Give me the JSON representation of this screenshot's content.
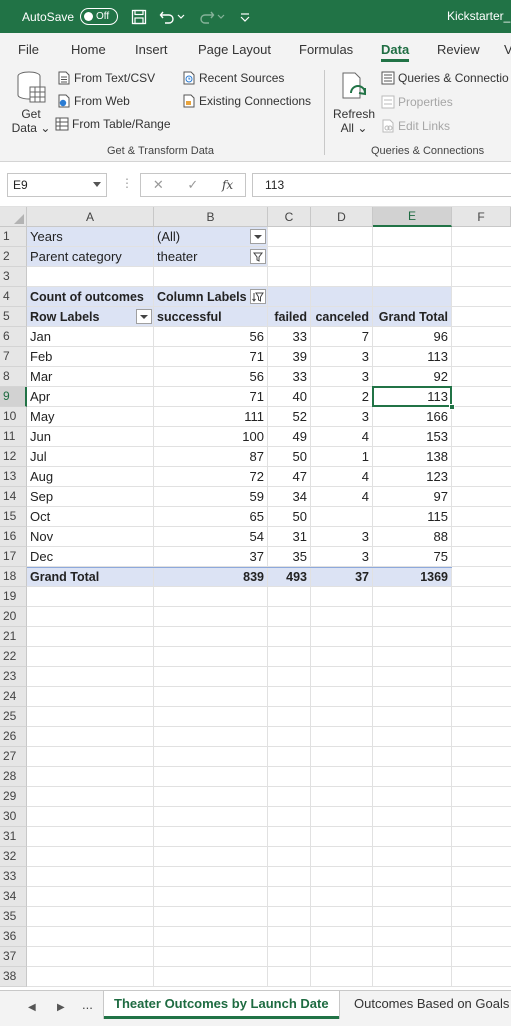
{
  "titlebar": {
    "autosave_label": "AutoSave",
    "autosave_state": "Off",
    "file_title": "Kickstarter_C"
  },
  "ribbon_tabs": [
    {
      "label": "File"
    },
    {
      "label": "Home"
    },
    {
      "label": "Insert"
    },
    {
      "label": "Page Layout"
    },
    {
      "label": "Formulas"
    },
    {
      "label": "Data",
      "active": true
    },
    {
      "label": "Review"
    },
    {
      "label": "V"
    }
  ],
  "ribbon": {
    "get_data": {
      "line1": "Get",
      "line2": "Data"
    },
    "from_text_csv": "From Text/CSV",
    "from_web": "From Web",
    "from_table_range": "From Table/Range",
    "recent_sources": "Recent Sources",
    "existing_connections": "Existing Connections",
    "group_get_transform": "Get & Transform Data",
    "refresh_all": {
      "line1": "Refresh",
      "line2": "All"
    },
    "queries_connections": "Queries & Connectio",
    "properties": "Properties",
    "edit_links": "Edit Links",
    "group_queries": "Queries & Connections",
    "accent": "#217346"
  },
  "formula_bar": {
    "name_box": "E9",
    "fx_label": "fx",
    "value": "113"
  },
  "columns": [
    "A",
    "B",
    "C",
    "D",
    "E",
    "F"
  ],
  "selected_column": "E",
  "selected_row": 9,
  "filters": {
    "years_label": "Years",
    "years_value": "(All)",
    "parent_label": "Parent category",
    "parent_value": "theater"
  },
  "pivot": {
    "count_label": "Count of outcomes",
    "column_labels": "Column Labels",
    "row_labels": "Row Labels",
    "headers": [
      "successful",
      "failed",
      "canceled",
      "Grand Total"
    ],
    "rows": [
      {
        "label": "Jan",
        "successful": "56",
        "failed": "33",
        "canceled": "7",
        "total": "96"
      },
      {
        "label": "Feb",
        "successful": "71",
        "failed": "39",
        "canceled": "3",
        "total": "113"
      },
      {
        "label": "Mar",
        "successful": "56",
        "failed": "33",
        "canceled": "3",
        "total": "92"
      },
      {
        "label": "Apr",
        "successful": "71",
        "failed": "40",
        "canceled": "2",
        "total": "113"
      },
      {
        "label": "May",
        "successful": "111",
        "failed": "52",
        "canceled": "3",
        "total": "166"
      },
      {
        "label": "Jun",
        "successful": "100",
        "failed": "49",
        "canceled": "4",
        "total": "153"
      },
      {
        "label": "Jul",
        "successful": "87",
        "failed": "50",
        "canceled": "1",
        "total": "138"
      },
      {
        "label": "Aug",
        "successful": "72",
        "failed": "47",
        "canceled": "4",
        "total": "123"
      },
      {
        "label": "Sep",
        "successful": "59",
        "failed": "34",
        "canceled": "4",
        "total": "97"
      },
      {
        "label": "Oct",
        "successful": "65",
        "failed": "50",
        "canceled": "",
        "total": "115"
      },
      {
        "label": "Nov",
        "successful": "54",
        "failed": "31",
        "canceled": "3",
        "total": "88"
      },
      {
        "label": "Dec",
        "successful": "37",
        "failed": "35",
        "canceled": "3",
        "total": "75"
      }
    ],
    "grand_total": {
      "label": "Grand Total",
      "successful": "839",
      "failed": "493",
      "canceled": "37",
      "total": "1369"
    }
  },
  "row_numbers": [
    "1",
    "2",
    "3",
    "4",
    "5",
    "6",
    "7",
    "8",
    "9",
    "10",
    "11",
    "12",
    "13",
    "14",
    "15",
    "16",
    "17",
    "18",
    "19",
    "20",
    "21",
    "22",
    "23",
    "24",
    "25",
    "26",
    "27",
    "28",
    "29",
    "30",
    "31",
    "32",
    "33",
    "34",
    "35",
    "36",
    "37",
    "38"
  ],
  "sheet_tabs": {
    "ellipsis": "...",
    "active": "Theater Outcomes by Launch Date",
    "other": "Outcomes Based on Goals"
  }
}
